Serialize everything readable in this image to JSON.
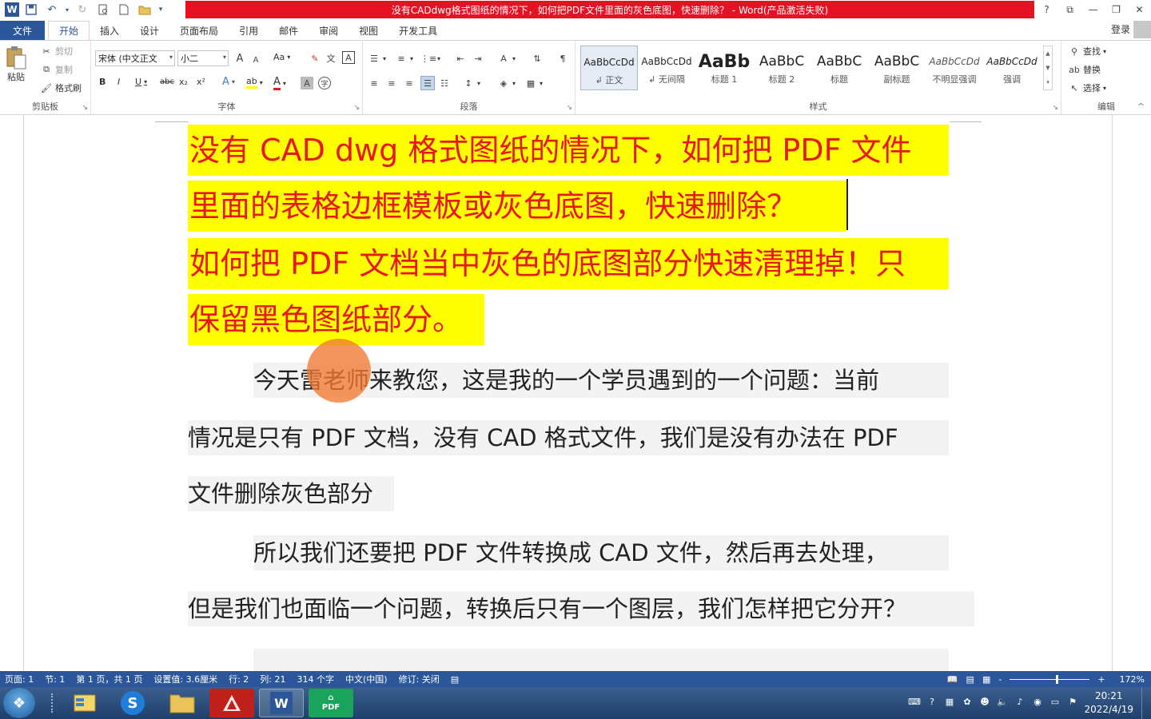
{
  "window": {
    "title": "没有CADdwg格式图纸的情况下，如何把PDF文件里面的灰色底图，快速删除？ - Word(产品激活失败)",
    "controls": {
      "help": "?",
      "ribbon_display": "⧉",
      "minimize": "—",
      "restore": "❐",
      "close": "✕"
    }
  },
  "quick_access": {
    "icons": [
      "word-logo",
      "save-icon",
      "undo-icon",
      "redo-icon",
      "print-preview-icon",
      "new-icon",
      "open-icon",
      "customize-icon"
    ],
    "word_logo": "W"
  },
  "tabs": {
    "file": "文件",
    "items": [
      "开始",
      "插入",
      "设计",
      "页面布局",
      "引用",
      "邮件",
      "审阅",
      "视图",
      "开发工具"
    ],
    "active": "开始",
    "login": "登录"
  },
  "ribbon": {
    "clipboard": {
      "label": "剪贴板",
      "paste": "粘贴",
      "cut": "剪切",
      "copy": "复制",
      "format_painter": "格式刷"
    },
    "font": {
      "label": "字体",
      "font_name": "宋体 (中文正文",
      "font_size": "小二",
      "bold": "B",
      "italic": "I",
      "underline": "U",
      "strike": "abc",
      "subscript": "x₂",
      "superscript": "x²",
      "grow": "A",
      "shrink": "A",
      "change_case": "Aa",
      "char_border": "A",
      "font_color_letter": "A",
      "highlight_letter": "ab",
      "shading_letter": "A",
      "enclose": "字"
    },
    "paragraph": {
      "label": "段落"
    },
    "styles": {
      "label": "样式",
      "items": [
        {
          "preview": "AaBbCcDd",
          "name": "↲ 正文",
          "selected": true
        },
        {
          "preview": "AaBbCcDd",
          "name": "↲ 无间隔",
          "selected": false
        },
        {
          "preview": "AaBb",
          "name": "标题 1",
          "selected": false
        },
        {
          "preview": "AaBbC",
          "name": "标题 2",
          "selected": false
        },
        {
          "preview": "AaBbC",
          "name": "标题",
          "selected": false
        },
        {
          "preview": "AaBbC",
          "name": "副标题",
          "selected": false
        },
        {
          "preview": "AaBbCcDd",
          "name": "不明显强调",
          "selected": false
        },
        {
          "preview": "AaBbCcDd",
          "name": "强调",
          "selected": false
        }
      ]
    },
    "editing": {
      "label": "编辑",
      "find": "查找",
      "replace": "替换",
      "select": "选择"
    }
  },
  "document": {
    "heading_lines": [
      "没有 CAD dwg 格式图纸的情况下，如何把 PDF 文件",
      "里面的表格边框模板或灰色底图，快速删除？",
      "如何把 PDF 文档当中灰色的底图部分快速清理掉！只",
      "保留黑色图纸部分。"
    ],
    "body_lines": [
      "今天雷老师来教您，这是我的一个学员遇到的一个问题：当前",
      "情况是只有 PDF 文档，没有 CAD 格式文件，我们是没有办法在 PDF",
      "文件删除灰色部分",
      "所以我们还要把 PDF 文件转换成 CAD 文件，然后再去处理，",
      "但是我们也面临一个问题，转换后只有一个图层，我们怎样把它分开？"
    ],
    "highlight_color": "#ffff00",
    "heading_color": "#e81818"
  },
  "statusbar": {
    "items": [
      "页面: 1",
      "节: 1",
      "第 1 页，共 1 页",
      "设置值: 3.6厘米",
      "行: 2",
      "列: 21",
      "314 个字",
      "中文(中国)",
      "修订: 关闭"
    ],
    "zoom_percent": "172%",
    "zoom_minus": "-",
    "zoom_plus": "+"
  },
  "taskbar": {
    "apps": [
      "file-explorer-icon",
      "sogou-icon",
      "folder-icon",
      "autocad-icon",
      "word-icon",
      "pdf-icon"
    ],
    "pdf_label": "PDF",
    "time": "20:21",
    "date": "2022/4/19"
  },
  "colors": {
    "accent": "#2b579a",
    "title_red": "#e81123",
    "statusbar": "#2b579a"
  }
}
